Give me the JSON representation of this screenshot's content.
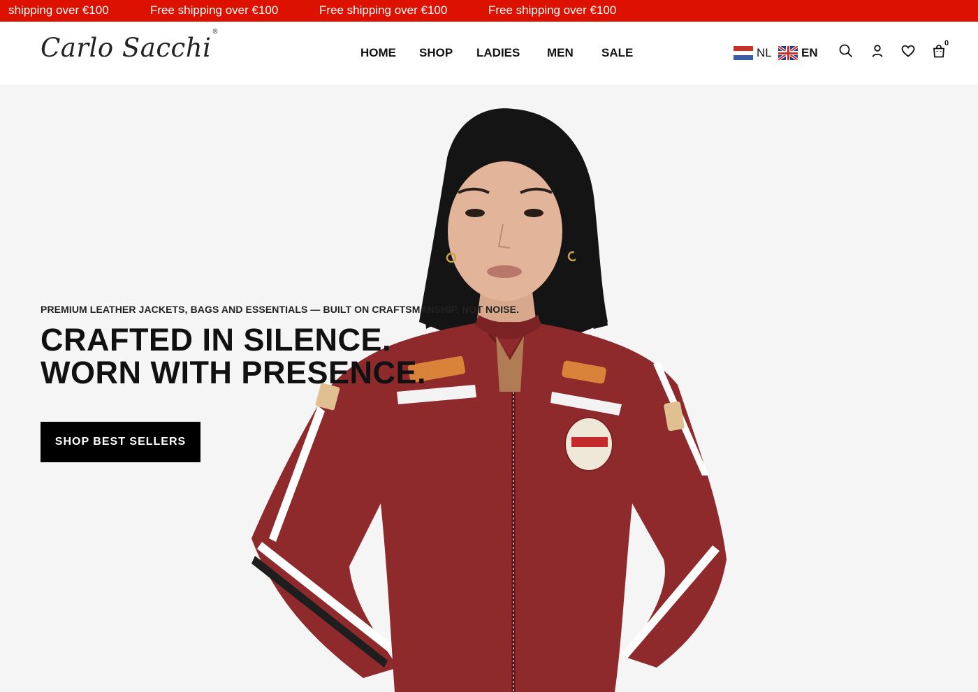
{
  "announcement": {
    "messages": [
      "shipping over €100",
      "Free shipping over €100",
      "Free shipping over €100",
      "Free shipping over €100"
    ]
  },
  "brand": {
    "logo": "Carlo Sacchi",
    "registered": "®"
  },
  "nav": {
    "items": [
      {
        "label": "HOME"
      },
      {
        "label": "SHOP"
      },
      {
        "label": "LADIES"
      },
      {
        "label": "MEN"
      },
      {
        "label": "SALE"
      }
    ]
  },
  "languages": [
    {
      "code": "NL",
      "flag": "netherlands-flag-icon",
      "active": false
    },
    {
      "code": "EN",
      "flag": "united-kingdom-flag-icon",
      "active": true
    }
  ],
  "header_icons": [
    "search-icon",
    "account-icon",
    "heart-icon",
    "bag-icon"
  ],
  "cart": {
    "count": "0"
  },
  "hero": {
    "tagline": "PREMIUM LEATHER JACKETS, BAGS AND ESSENTIALS — BUILT ON CRAFTSMANSHIP, NOT NOISE.",
    "headline_line1": "CRAFTED IN SILENCE.",
    "headline_line2": "WORN WITH PRESENCE.",
    "cta_label": "SHOP BEST SELLERS"
  },
  "colors": {
    "announcement_bg": "#dd1100",
    "jacket_red": "#8e2a2c",
    "cta_bg": "#000000"
  }
}
